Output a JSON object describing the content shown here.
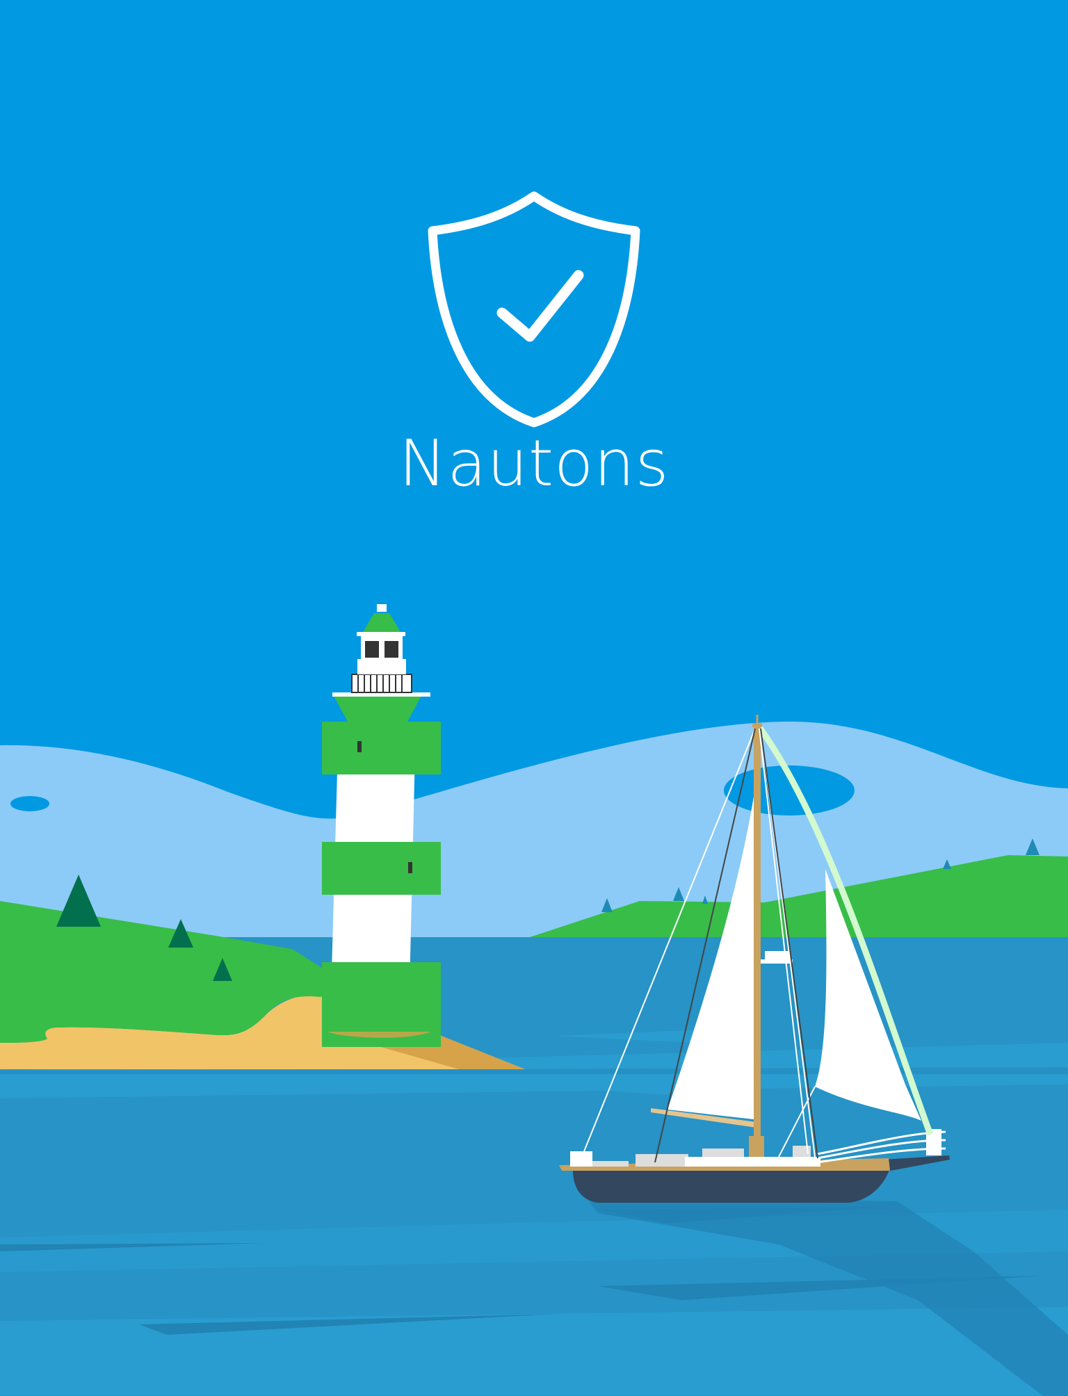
{
  "app": {
    "name": "Nautons",
    "logo_icon": "shield-check-icon"
  },
  "colors": {
    "sky": "#0299e3",
    "far_hills": "#8ccbf7",
    "grass": "#38bd49",
    "sand": "#f2c468",
    "sea": "#2793c6",
    "lighthouse_green": "#38bd49",
    "hull": "#33475e",
    "mast": "#c8a25e"
  },
  "scene": {
    "illustrations": [
      "lighthouse-illustration",
      "sailboat-illustration"
    ]
  }
}
